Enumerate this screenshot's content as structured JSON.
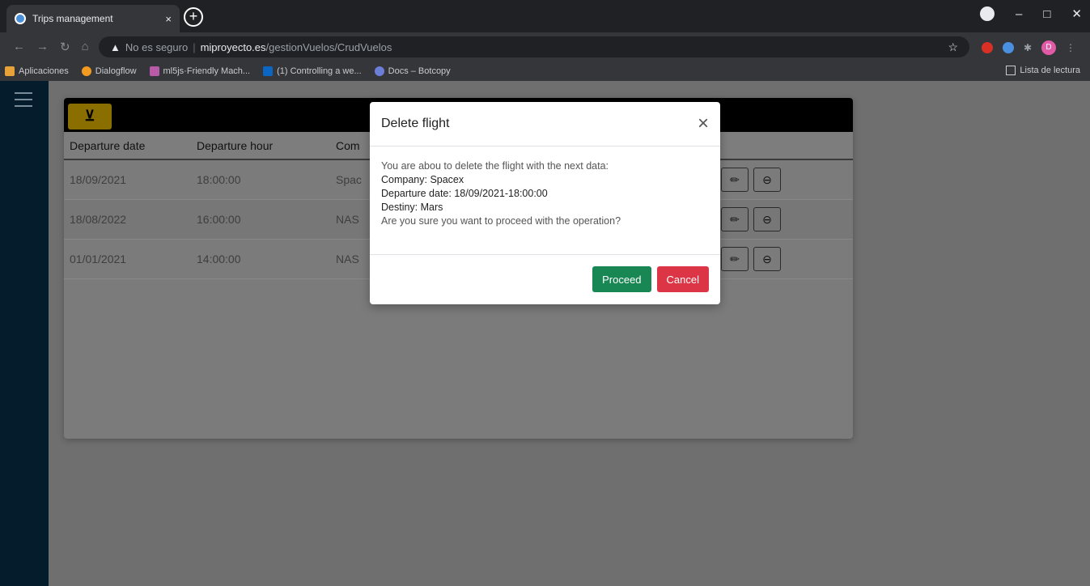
{
  "browser": {
    "tab_title": "Trips management",
    "tab_close": "×",
    "new_tab": "+",
    "address": {
      "warning": "No es seguro",
      "host": "miproyecto.es",
      "path": "/gestionVuelos/CrudVuelos"
    },
    "bookmarks": [
      {
        "label": "Aplicaciones",
        "color": "#e8a23a"
      },
      {
        "label": "Dialogflow",
        "color": "#f29b20"
      },
      {
        "label": "ml5js·Friendly Mach...",
        "color": "#b75aa8"
      },
      {
        "label": "(1) Controlling a we...",
        "color": "#0a66c2"
      },
      {
        "label": "Docs – Botcopy",
        "color": "#6b7fd7"
      }
    ],
    "reading_list": "Lista de lectura",
    "profile_initial": "D"
  },
  "app": {
    "colors": {
      "sidebar": "#051c2c",
      "proceed": "#198754",
      "cancel": "#dc3545",
      "accent": "#8a6e00"
    },
    "table": {
      "headers": [
        "Departure date",
        "Departure hour",
        "Com"
      ],
      "rows": [
        {
          "date": "18/09/2021",
          "hour": "18:00:00",
          "company": "Spac"
        },
        {
          "date": "18/08/2022",
          "hour": "16:00:00",
          "company": "NAS"
        },
        {
          "date": "01/01/2021",
          "hour": "14:00:00",
          "company": "NAS"
        }
      ]
    }
  },
  "modal": {
    "title": "Delete flight",
    "close": "×",
    "intro": "You are abou to delete the flight with the next data:",
    "company": "Company: Spacex",
    "departure": "Departure date: 18/09/2021-18:00:00",
    "destiny": "Destiny: Mars",
    "question": "Are you sure you want to proceed with the operation?",
    "proceed_label": "Proceed",
    "cancel_label": "Cancel"
  }
}
